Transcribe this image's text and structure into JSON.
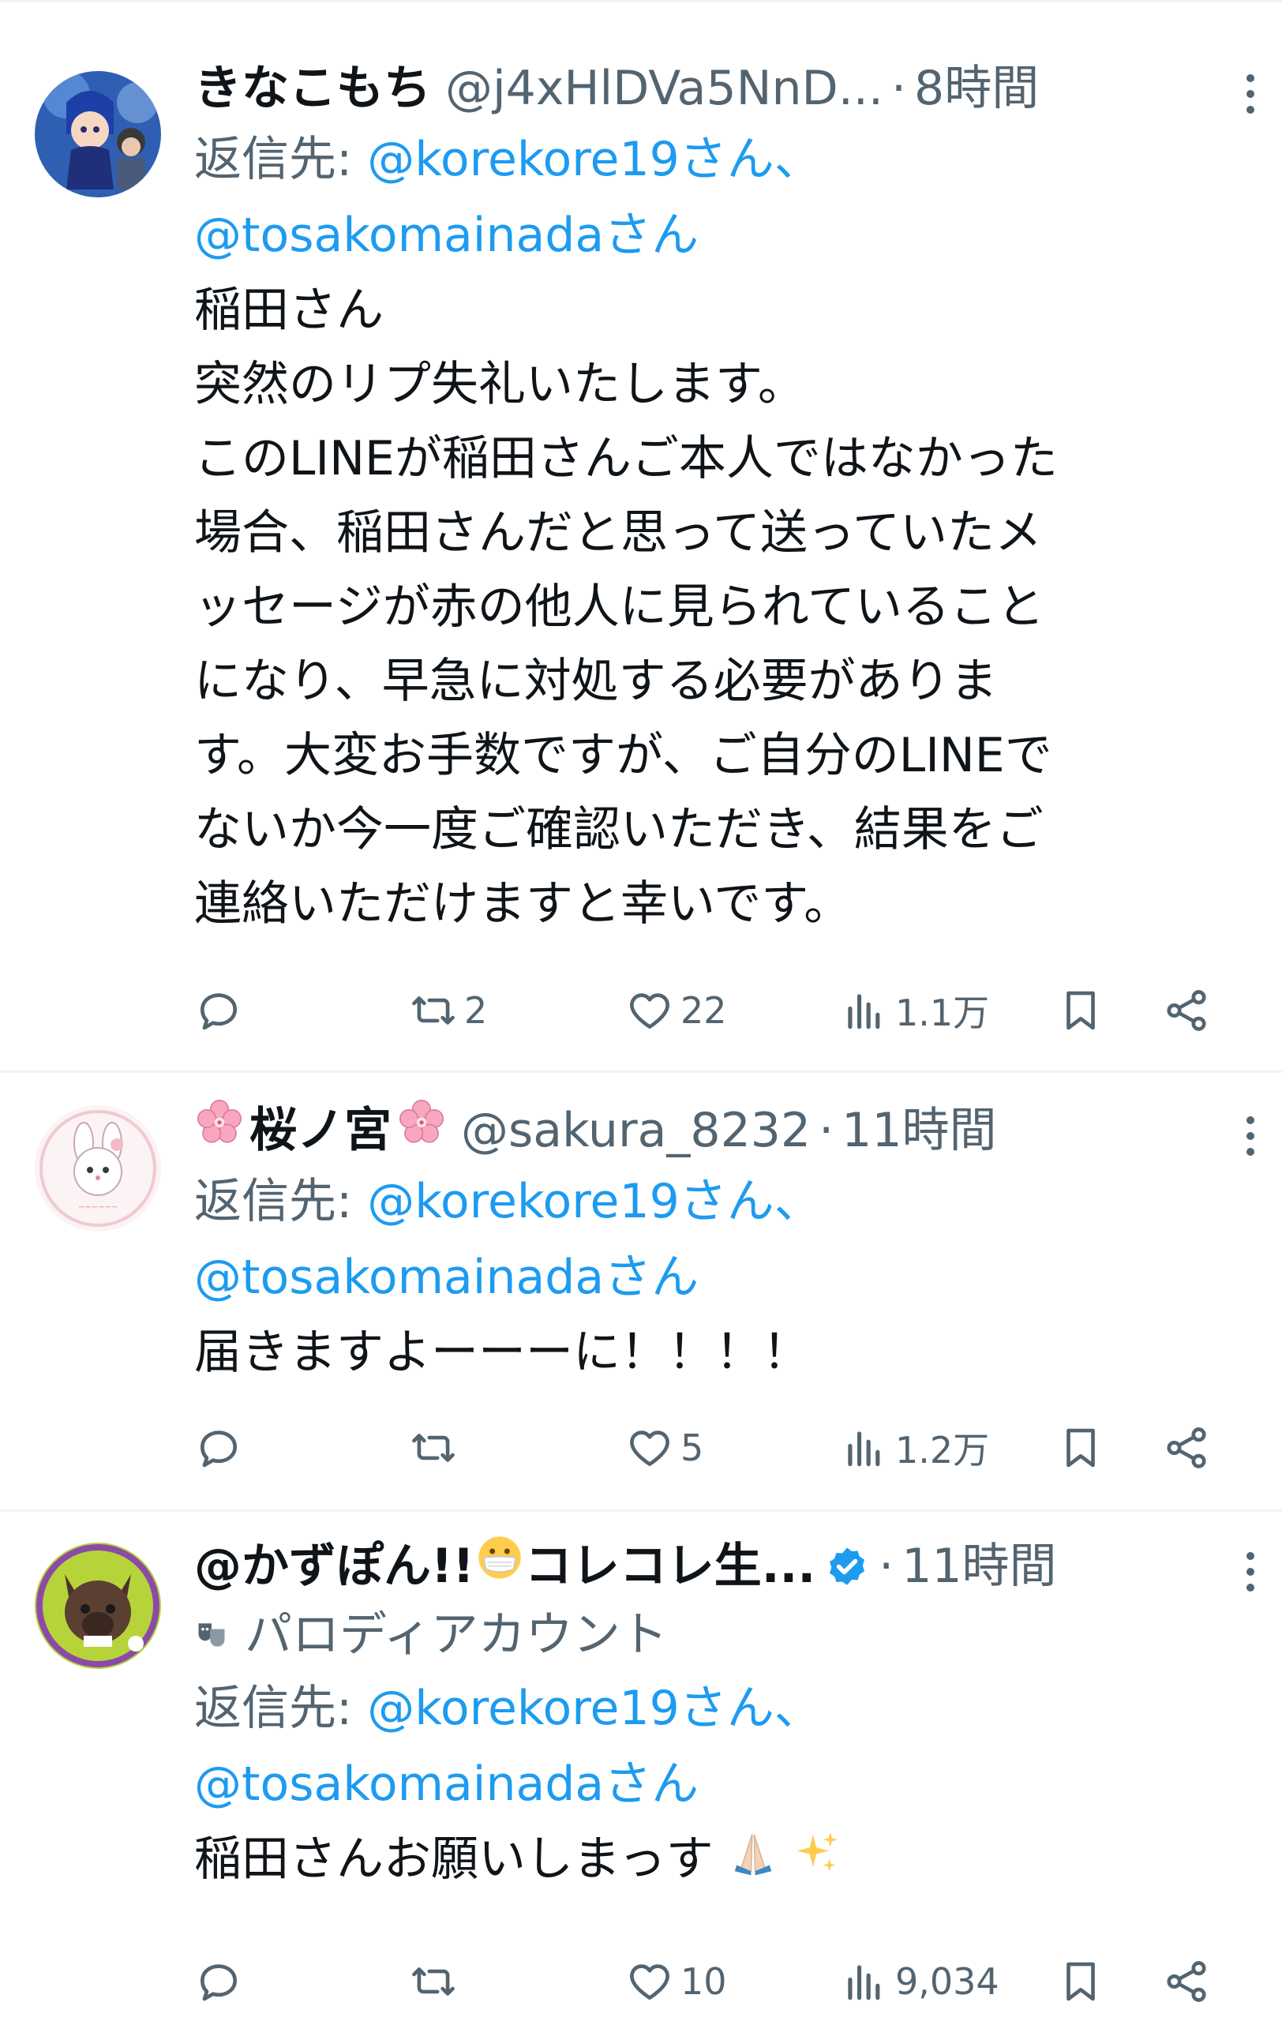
{
  "tweets": [
    {
      "display_name": "きなこもち",
      "handle": "@j4xHlDVa5NnD...",
      "time": "8時間",
      "reply_prefix": "返信先: ",
      "reply_to_1": "@korekore19さん、",
      "reply_to_2": "@tosakomainadaさん",
      "body_lines": [
        "稲田さん",
        "突然のリプ失礼いたします。",
        "このLINEが稲田さんご本人ではなかった",
        "場合、稲田さんだと思って送っていたメ",
        "ッセージが赤の他人に見られていること",
        "になり、早急に対処する必要がありま",
        "す。大変お手数ですが、ご自分のLINEで",
        "ないか今一度ご確認いただき、結果をご",
        "連絡いただけますと幸いです。"
      ],
      "retweets": "2",
      "likes": "22",
      "views": "1.1万"
    },
    {
      "display_name": "桜ノ宮",
      "handle": "@sakura_8232",
      "time": "11時間",
      "reply_prefix": "返信先: ",
      "reply_to_1": "@korekore19さん、",
      "reply_to_2": "@tosakomainadaさん",
      "body_lines": [
        "届きますよーーーに！！！！"
      ],
      "retweets": "",
      "likes": "5",
      "views": "1.2万"
    },
    {
      "display_name": "@かずぽん!!",
      "display_name_suffix": "コレコレ生...",
      "parody_label": "パロディアカウント",
      "time": "11時間",
      "reply_prefix": "返信先: ",
      "reply_to_1": "@korekore19さん、",
      "reply_to_2": "@tosakomainadaさん",
      "body_lines": [
        "稲田さんお願いしまっす"
      ],
      "retweets": "",
      "likes": "10",
      "views": "9,034"
    }
  ],
  "icons": {
    "reply": "reply-icon",
    "retweet": "retweet-icon",
    "like": "heart-icon",
    "views": "views-icon",
    "bookmark": "bookmark-icon",
    "share": "share-icon",
    "more": "more-icon",
    "verified": "verified-badge-icon",
    "parody": "parody-mask-icon"
  },
  "colors": {
    "text": "#0f1419",
    "secondary": "#536471",
    "link": "#1d9bf0",
    "divider": "#eff3f4"
  }
}
